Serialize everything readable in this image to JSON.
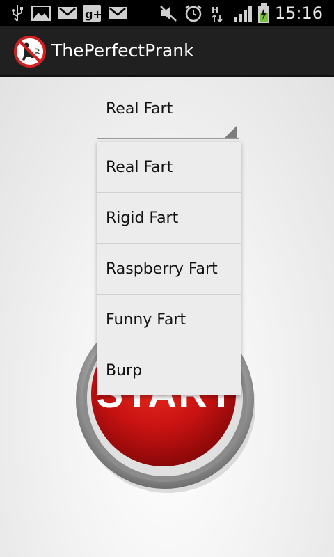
{
  "status_bar": {
    "time": "15:16",
    "icons": [
      "usb-icon",
      "gallery-icon",
      "gmail-icon",
      "google-plus-icon",
      "gmail-icon",
      "mute-icon",
      "alarm-icon",
      "network-h-icon",
      "signal-icon",
      "battery-charging-icon"
    ]
  },
  "action_bar": {
    "title": "ThePerfectPrank",
    "icon": "no-fart-icon"
  },
  "spinner": {
    "selected": "Real Fart"
  },
  "dropdown": {
    "options": [
      "Real Fart",
      "Rigid Fart",
      "Raspberry Fart",
      "Funny Fart",
      "Burp"
    ]
  },
  "start_button": {
    "label": "START"
  },
  "colors": {
    "action_bar": "#202020",
    "button_red": "#d01818",
    "dropdown_bg": "#ececec"
  }
}
